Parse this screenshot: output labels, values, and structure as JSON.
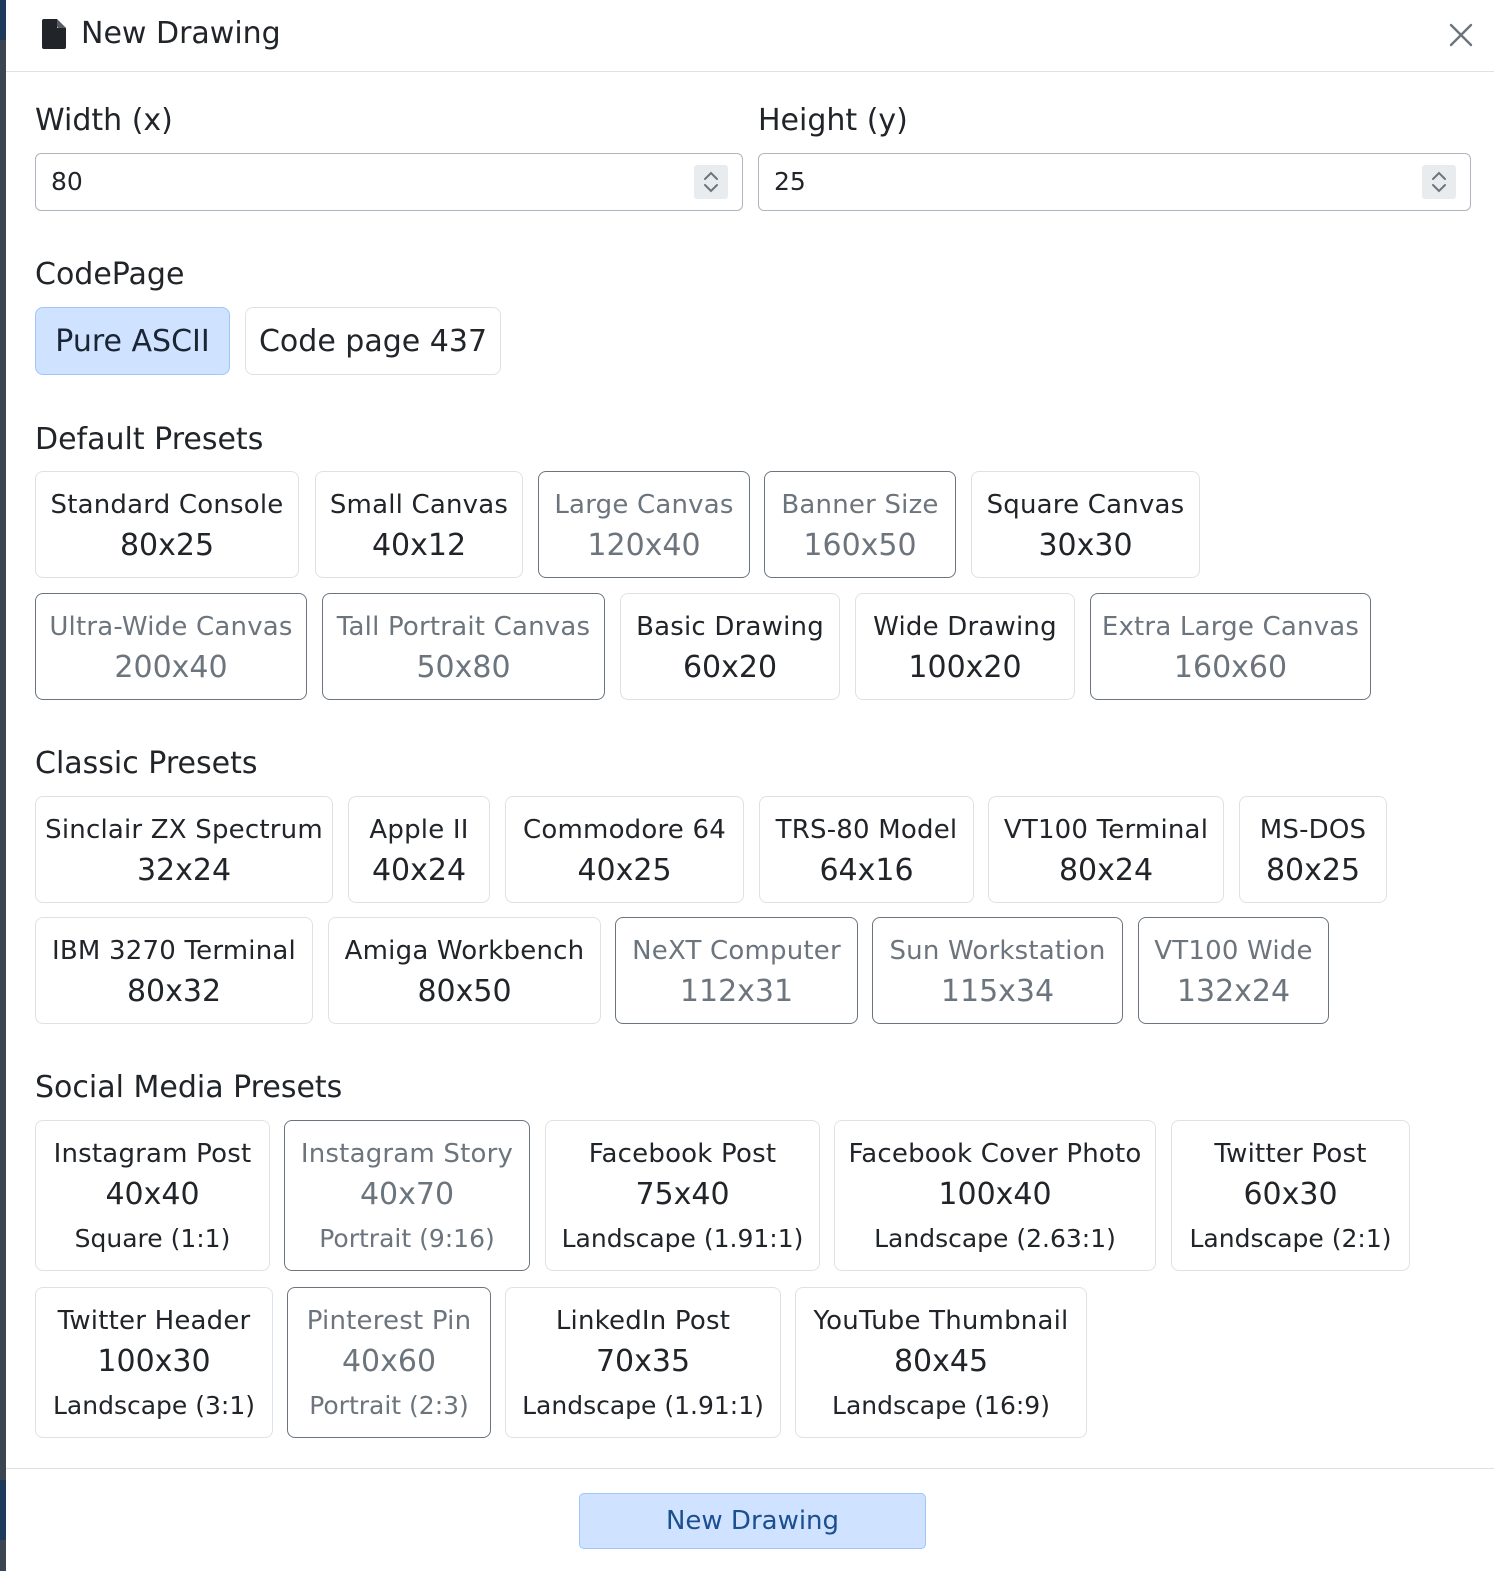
{
  "dialog": {
    "title": "New Drawing",
    "title_icon": "file-icon",
    "close_icon": "close-icon"
  },
  "dimensions": {
    "width_label": "Width (x)",
    "width_value": "80",
    "height_label": "Height (y)",
    "height_value": "25"
  },
  "codepage": {
    "label": "CodePage",
    "options": [
      "Pure ASCII",
      "Code page 437"
    ],
    "selected": "Pure ASCII"
  },
  "default_presets": {
    "title": "Default Presets",
    "items": [
      {
        "name": "Standard Console",
        "size": "80x25"
      },
      {
        "name": "Small Canvas",
        "size": "40x12"
      },
      {
        "name": "Large Canvas",
        "size": "120x40"
      },
      {
        "name": "Banner Size",
        "size": "160x50"
      },
      {
        "name": "Square Canvas",
        "size": "30x30"
      },
      {
        "name": "Ultra-Wide Canvas",
        "size": "200x40"
      },
      {
        "name": "Tall Portrait Canvas",
        "size": "50x80"
      },
      {
        "name": "Basic Drawing",
        "size": "60x20"
      },
      {
        "name": "Wide Drawing",
        "size": "100x20"
      },
      {
        "name": "Extra Large Canvas",
        "size": "160x60"
      }
    ]
  },
  "classic_presets": {
    "title": "Classic Presets",
    "items": [
      {
        "name": "Sinclair ZX Spectrum",
        "size": "32x24"
      },
      {
        "name": "Apple II",
        "size": "40x24"
      },
      {
        "name": "Commodore 64",
        "size": "40x25"
      },
      {
        "name": "TRS-80 Model",
        "size": "64x16"
      },
      {
        "name": "VT100 Terminal",
        "size": "80x24"
      },
      {
        "name": "MS-DOS",
        "size": "80x25"
      },
      {
        "name": "IBM 3270 Terminal",
        "size": "80x32"
      },
      {
        "name": "Amiga Workbench",
        "size": "80x50"
      },
      {
        "name": "NeXT Computer",
        "size": "112x31"
      },
      {
        "name": "Sun Workstation",
        "size": "115x34"
      },
      {
        "name": "VT100 Wide",
        "size": "132x24"
      }
    ]
  },
  "social_presets": {
    "title": "Social Media Presets",
    "items": [
      {
        "name": "Instagram Post",
        "size": "40x40",
        "ratio": "Square (1:1)"
      },
      {
        "name": "Instagram Story",
        "size": "40x70",
        "ratio": "Portrait (9:16)"
      },
      {
        "name": "Facebook Post",
        "size": "75x40",
        "ratio": "Landscape (1.91:1)"
      },
      {
        "name": "Facebook Cover Photo",
        "size": "100x40",
        "ratio": "Landscape (2.63:1)"
      },
      {
        "name": "Twitter Post",
        "size": "60x30",
        "ratio": "Landscape (2:1)"
      },
      {
        "name": "Twitter Header",
        "size": "100x30",
        "ratio": "Landscape (3:1)"
      },
      {
        "name": "Pinterest Pin",
        "size": "40x60",
        "ratio": "Portrait (2:3)"
      },
      {
        "name": "LinkedIn Post",
        "size": "70x35",
        "ratio": "Landscape (1.91:1)"
      },
      {
        "name": "YouTube Thumbnail",
        "size": "80x45",
        "ratio": "Landscape (16:9)"
      }
    ]
  },
  "footer": {
    "submit_label": "New Drawing"
  }
}
